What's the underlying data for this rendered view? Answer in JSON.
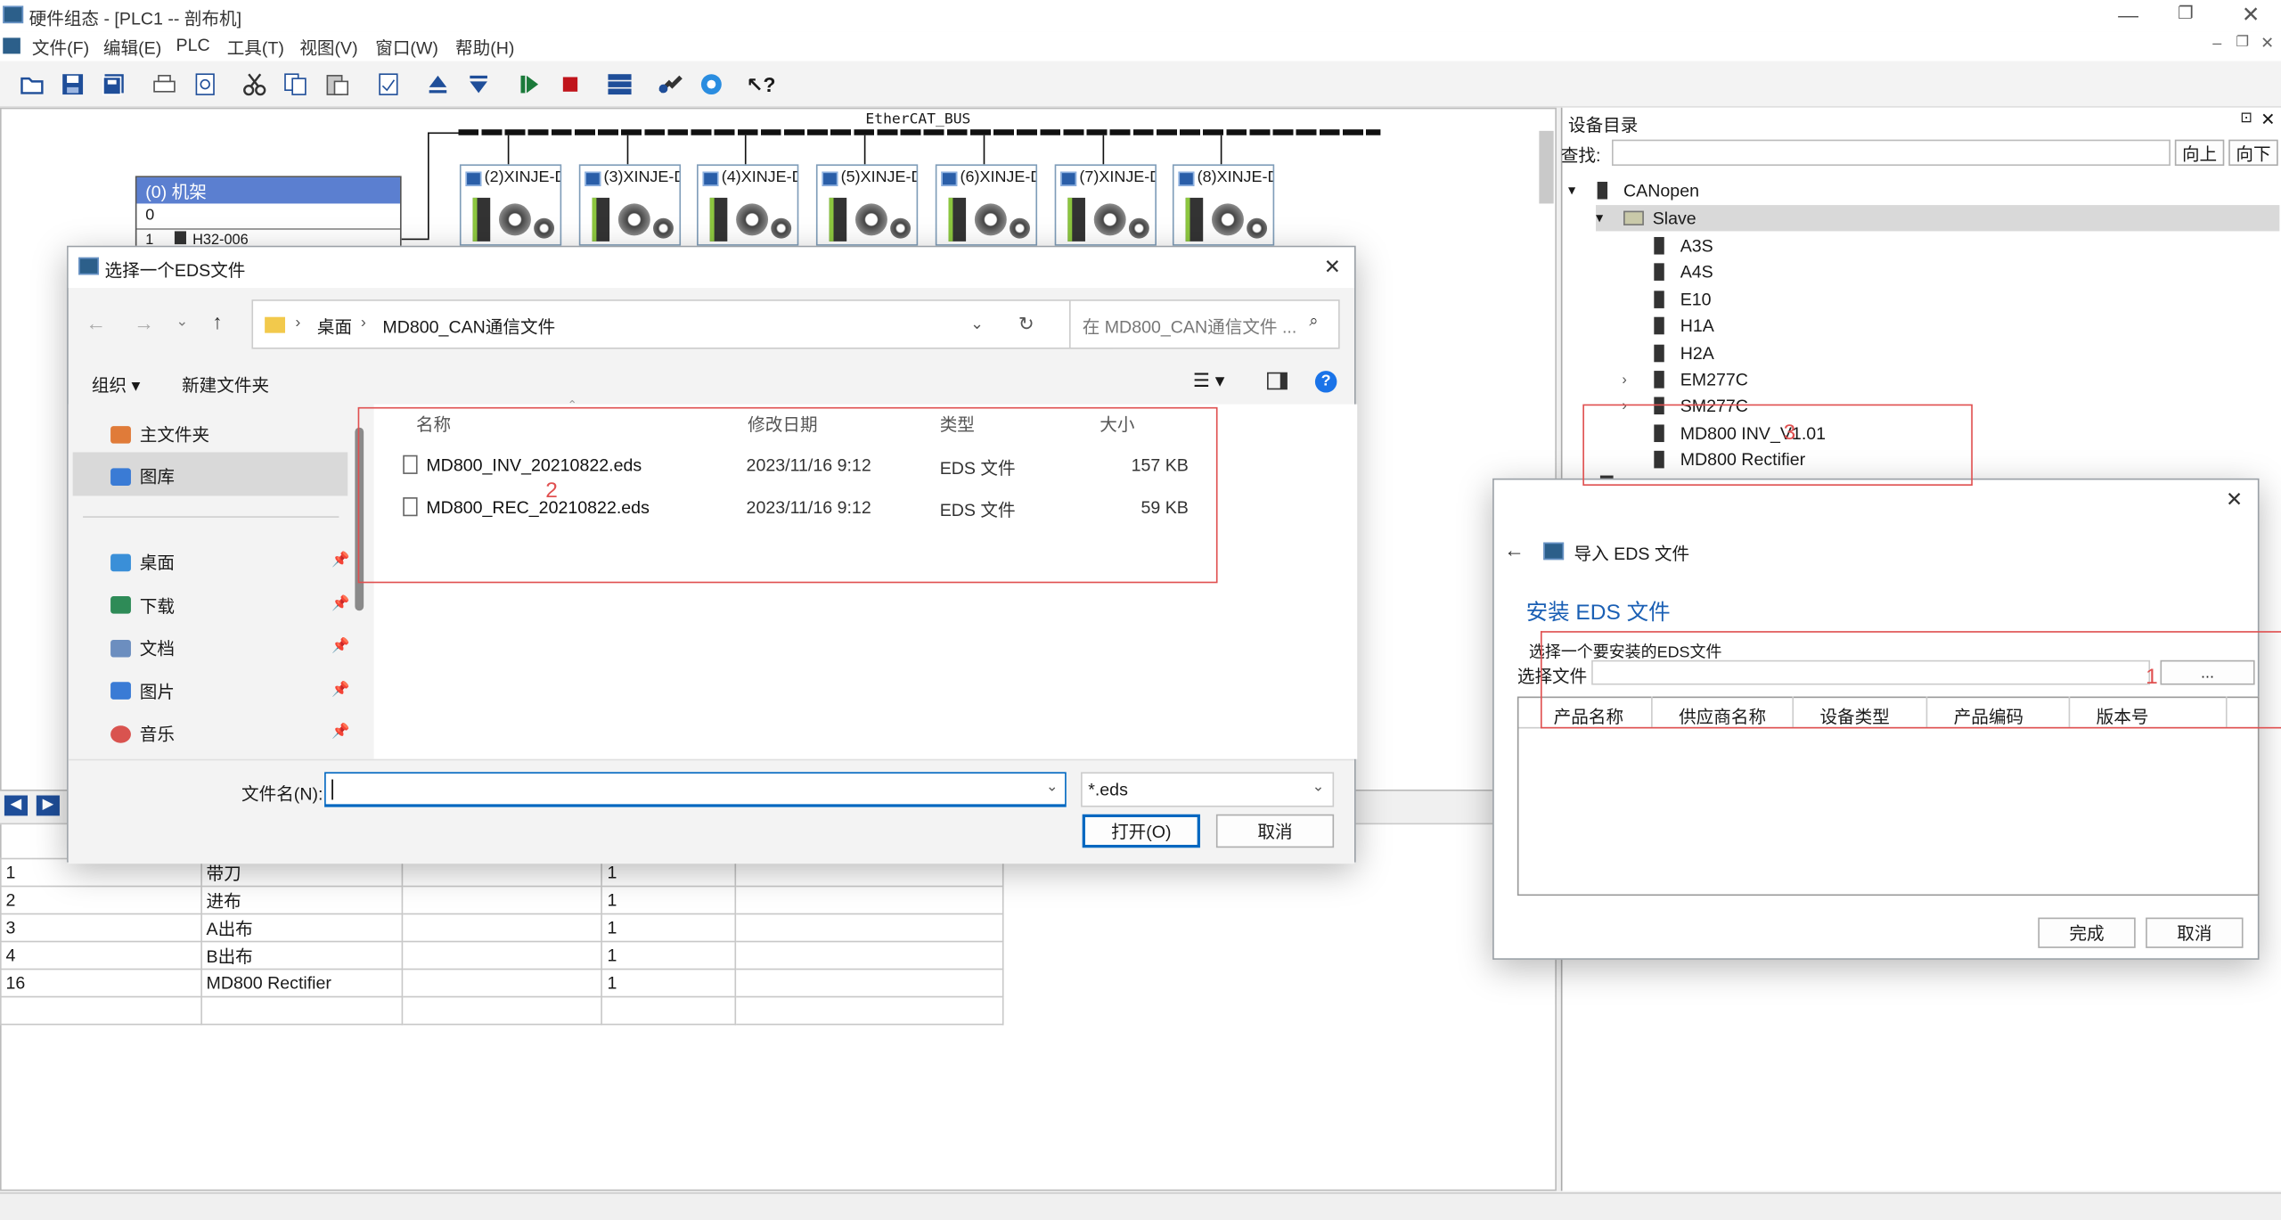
{
  "window": {
    "title": "硬件组态 - [PLC1 -- 剖布机]"
  },
  "menu": [
    "文件(F)",
    "编辑(E)",
    "PLC",
    "工具(T)",
    "视图(V)",
    "窗口(W)",
    "帮助(H)"
  ],
  "toolbar_icons": [
    "open-icon",
    "save-icon",
    "save-all-icon",
    "print-icon",
    "print-preview-icon",
    "cut-icon",
    "copy-icon",
    "paste-icon",
    "properties-icon",
    "upload-icon",
    "download-icon",
    "run-icon",
    "stop-icon",
    "config-icon",
    "link-icon",
    "network-icon",
    "help-icon"
  ],
  "diagram": {
    "bus_label": "EtherCAT_BUS",
    "rack_title": "(0) 机架",
    "rack_rows": [
      "0",
      "1"
    ],
    "rack_row1_device": "H32-006",
    "devices": [
      "(2)XINJE-D",
      "(3)XINJE-D",
      "(4)XINJE-D",
      "(5)XINJE-D",
      "(6)XINJE-D",
      "(7)XINJE-D",
      "(8)XINJE-D"
    ]
  },
  "bottom_table": {
    "rows": [
      [
        "1",
        "带刀",
        "",
        "1",
        ""
      ],
      [
        "2",
        "进布",
        "",
        "1",
        ""
      ],
      [
        "3",
        "A出布",
        "",
        "1",
        ""
      ],
      [
        "4",
        "B出布",
        "",
        "1",
        ""
      ],
      [
        "16",
        "MD800 Rectifier",
        "",
        "1",
        ""
      ],
      [
        "",
        "",
        "",
        "",
        ""
      ]
    ]
  },
  "catalog": {
    "title": "设备目录",
    "search_label": "查找:",
    "search_value": "",
    "up_button": "向上",
    "down_button": "向下",
    "tree": {
      "root": "CANopen",
      "folder": "Slave",
      "items": [
        "A3S",
        "A4S",
        "E10",
        "H1A",
        "H2A",
        "EM277C",
        "SM277C",
        "MD800 INV_V1.01",
        "MD800 Rectifier"
      ]
    }
  },
  "file_dialog": {
    "title": "选择一个EDS文件",
    "breadcrumb": [
      "桌面",
      "MD800_CAN通信文件"
    ],
    "search_placeholder": "在 MD800_CAN通信文件 ...",
    "organize": "组织",
    "new_folder": "新建文件夹",
    "nav_top": [
      "主文件夹",
      "图库"
    ],
    "nav_quick": [
      "桌面",
      "下载",
      "文档",
      "图片",
      "音乐"
    ],
    "columns": [
      "名称",
      "修改日期",
      "类型",
      "大小"
    ],
    "files": [
      {
        "name": "MD800_INV_20210822.eds",
        "date": "2023/11/16 9:12",
        "type": "EDS 文件",
        "size": "157 KB"
      },
      {
        "name": "MD800_REC_20210822.eds",
        "date": "2023/11/16 9:12",
        "type": "EDS 文件",
        "size": "59 KB"
      }
    ],
    "filename_label": "文件名(N):",
    "filename_value": "",
    "filter": "*.eds",
    "open_button": "打开(O)",
    "cancel_button": "取消"
  },
  "import_dialog": {
    "header": "导入 EDS 文件",
    "heading": "安装 EDS 文件",
    "instruction": "选择一个要安装的EDS文件",
    "file_label": "选择文件",
    "file_value": "",
    "browse_button": "...",
    "columns": [
      "产品名称",
      "供应商名称",
      "设备类型",
      "产品编码",
      "版本号"
    ],
    "finish_button": "完成",
    "cancel_button": "取消"
  },
  "annotations": {
    "box1": "1",
    "box2": "2",
    "box3": "3"
  },
  "colors": {
    "accent": "#0066cc",
    "annotation_red": "#e05050",
    "rack_header": "#5b7fd0",
    "selected_row": "#d9d9d9"
  }
}
